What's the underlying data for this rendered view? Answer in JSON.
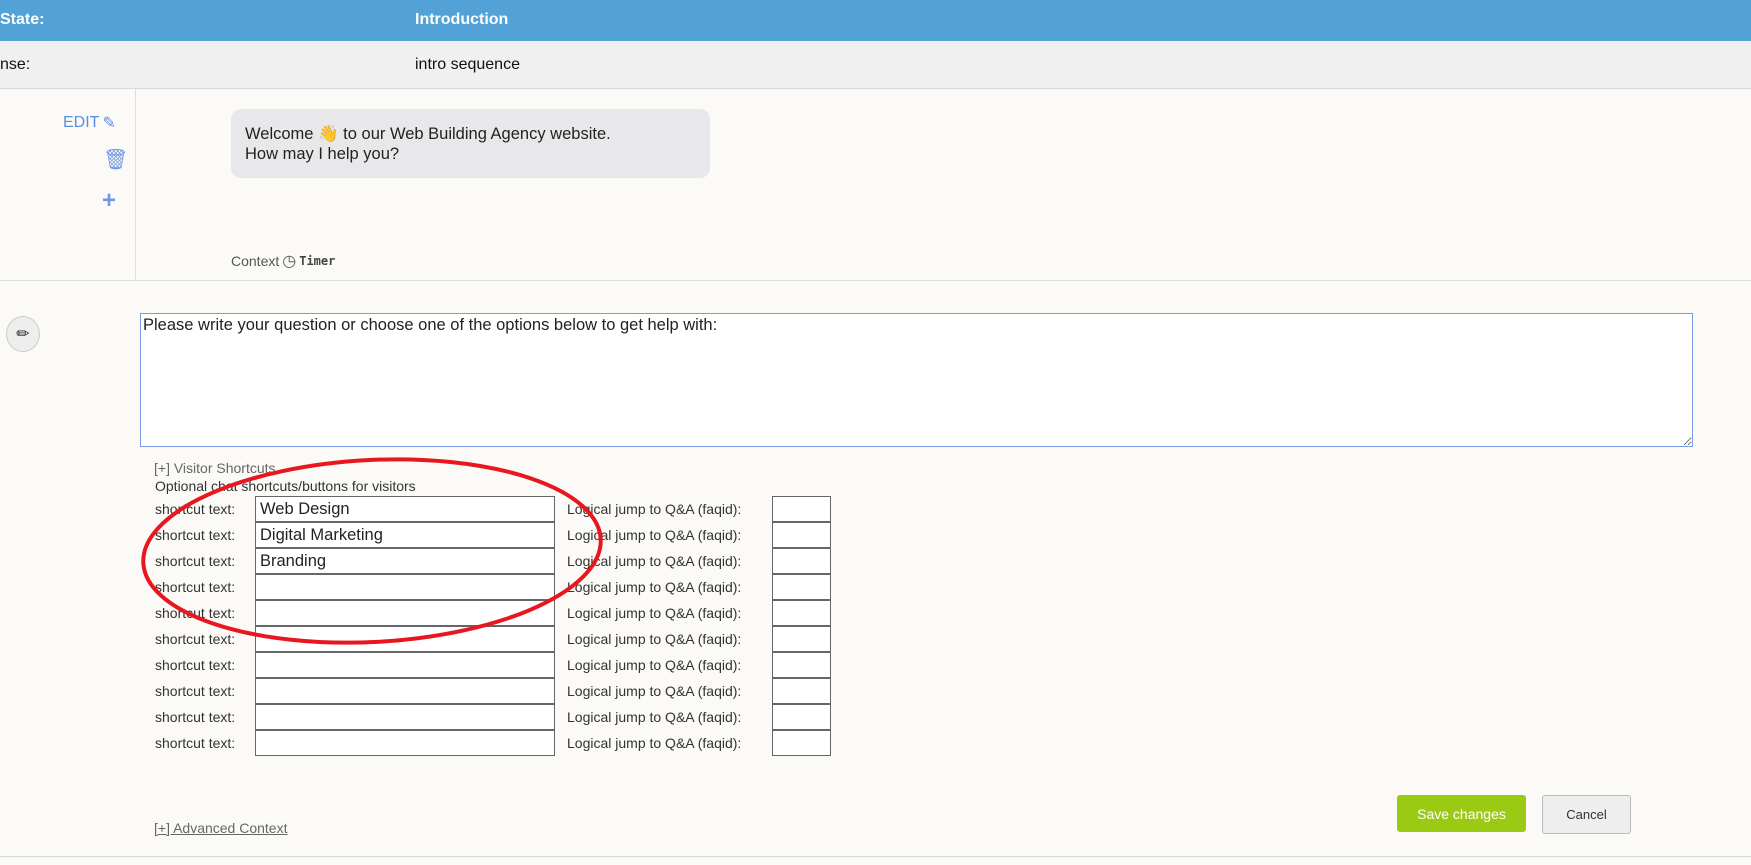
{
  "header": {
    "state_label": "State:",
    "state_value": "Introduction"
  },
  "response_row": {
    "label": "nse:",
    "value": "intro sequence"
  },
  "message": {
    "edit_label": "EDIT",
    "text_line1": "Welcome 👋 to our Web Building Agency website.",
    "text_line2": "How may I help you?",
    "context_label": "Context",
    "timer_label": "Timer"
  },
  "editor": {
    "textarea_value": "Please write your question or choose one of the options below to get help with:"
  },
  "shortcuts": {
    "toggle_label": "[+] Visitor Shortcuts",
    "description": "Optional chat shortcuts/buttons for visitors",
    "shortcut_label": "shortcut text:",
    "jump_label": "Logical jump to Q&A (faqid):",
    "rows": [
      {
        "text": "Web Design",
        "faqid": ""
      },
      {
        "text": "Digital Marketing",
        "faqid": ""
      },
      {
        "text": "Branding",
        "faqid": ""
      },
      {
        "text": "",
        "faqid": ""
      },
      {
        "text": "",
        "faqid": ""
      },
      {
        "text": "",
        "faqid": ""
      },
      {
        "text": "",
        "faqid": ""
      },
      {
        "text": "",
        "faqid": ""
      },
      {
        "text": "",
        "faqid": ""
      },
      {
        "text": "",
        "faqid": ""
      }
    ]
  },
  "advanced_label": "[+] Advanced Context",
  "buttons": {
    "save": "Save changes",
    "cancel": "Cancel"
  },
  "colors": {
    "header": "#52a2d8",
    "save": "#9bca14",
    "annotation": "#e8161e",
    "icons": "#6f98e6"
  }
}
